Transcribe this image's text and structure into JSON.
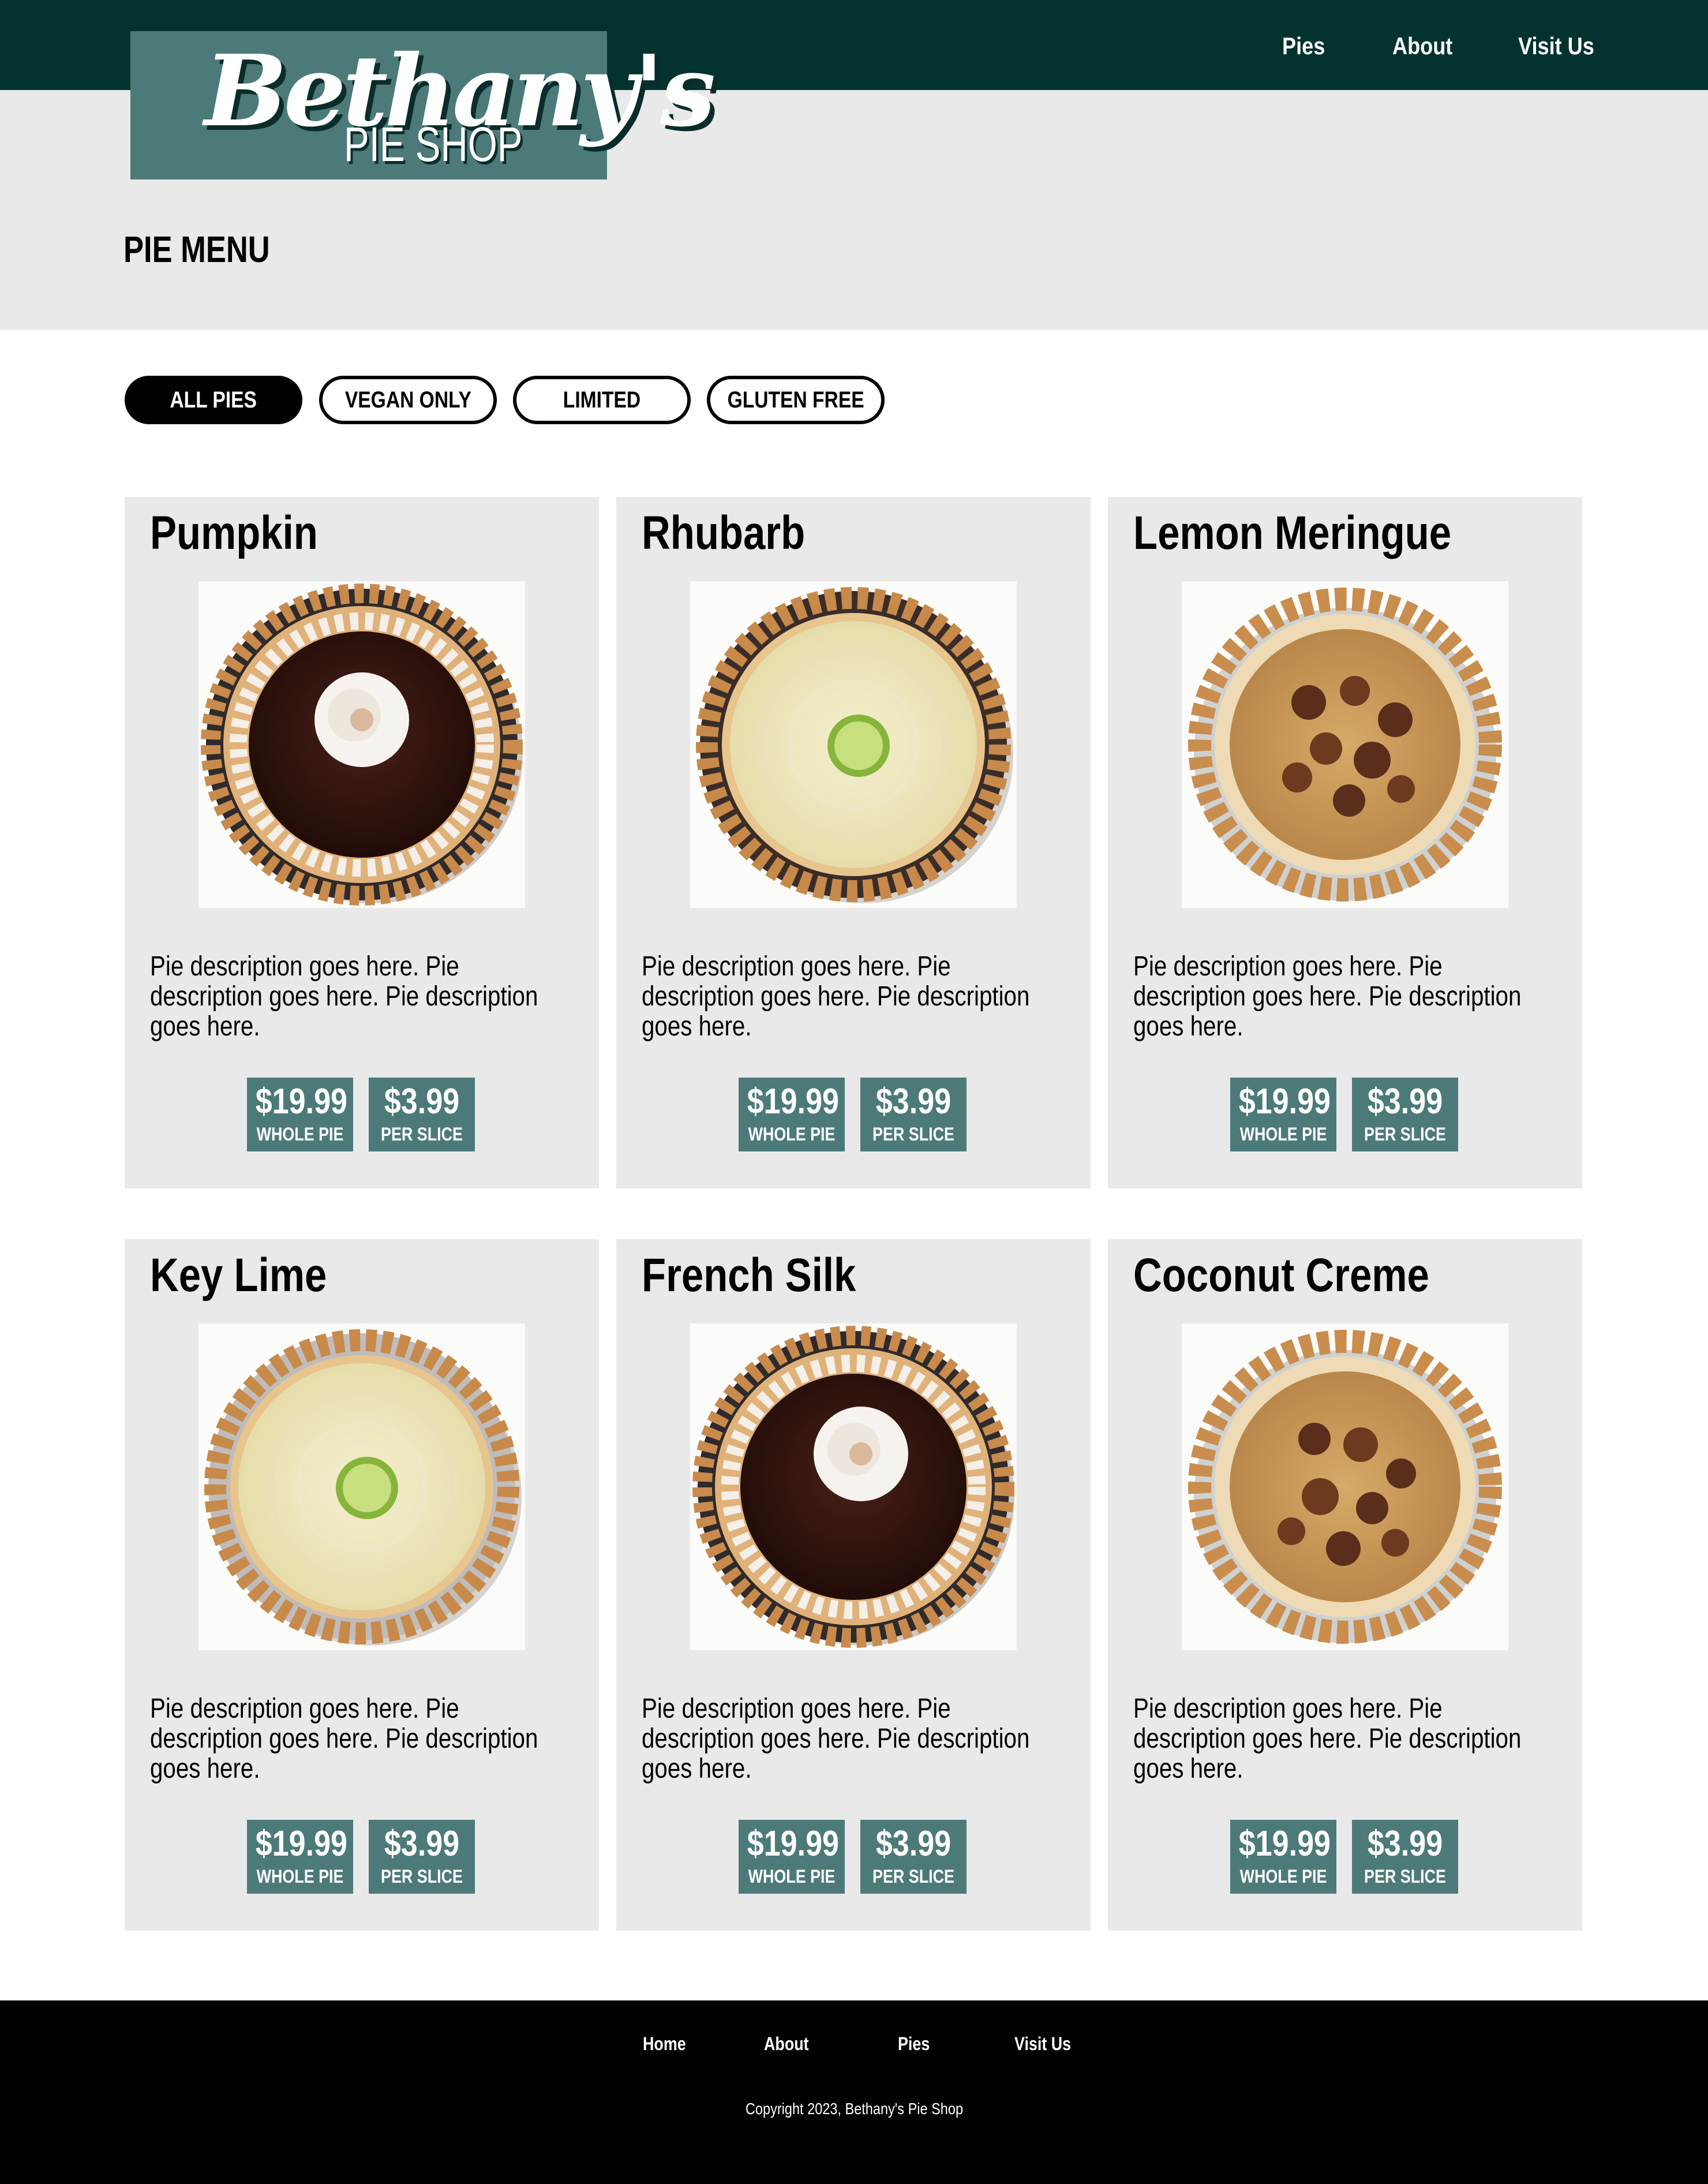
{
  "brand": {
    "script": "Bethany's",
    "sub": "PIE SHOP"
  },
  "nav": {
    "items": [
      "Pies",
      "About",
      "Visit Us"
    ]
  },
  "hero": {
    "title": "PIE MENU"
  },
  "filters": [
    {
      "label": "ALL PIES",
      "active": true
    },
    {
      "label": "VEGAN ONLY",
      "active": false
    },
    {
      "label": "LIMITED",
      "active": false
    },
    {
      "label": "GLUTEN FREE",
      "active": false
    }
  ],
  "pies": [
    {
      "name": "Pumpkin",
      "image": "chocolate-pie-photo",
      "description": "Pie description goes here. Pie description goes here. Pie description goes here.",
      "whole_price": "$19.99",
      "whole_label": "WHOLE PIE",
      "slice_price": "$3.99",
      "slice_label": "PER SLICE"
    },
    {
      "name": "Rhubarb",
      "image": "cream-lime-pie-photo",
      "description": "Pie description goes here. Pie description goes here. Pie description goes here.",
      "whole_price": "$19.99",
      "whole_label": "WHOLE PIE",
      "slice_price": "$3.99",
      "slice_label": "PER SLICE"
    },
    {
      "name": "Lemon Meringue",
      "image": "crumble-pie-photo",
      "description": "Pie description goes here. Pie description goes here. Pie description goes here.",
      "whole_price": "$19.99",
      "whole_label": "WHOLE PIE",
      "slice_price": "$3.99",
      "slice_label": "PER SLICE"
    },
    {
      "name": "Key Lime",
      "image": "cream-lime-pie-photo",
      "description": "Pie description goes here. Pie description goes here. Pie description goes here.",
      "whole_price": "$19.99",
      "whole_label": "WHOLE PIE",
      "slice_price": "$3.99",
      "slice_label": "PER SLICE"
    },
    {
      "name": "French Silk",
      "image": "chocolate-pie-photo",
      "description": "Pie description goes here. Pie description goes here. Pie description goes here.",
      "whole_price": "$19.99",
      "whole_label": "WHOLE PIE",
      "slice_price": "$3.99",
      "slice_label": "PER SLICE"
    },
    {
      "name": "Coconut Creme",
      "image": "crumble-pie-photo",
      "description": "Pie description goes here. Pie description goes here. Pie description goes here.",
      "whole_price": "$19.99",
      "whole_label": "WHOLE PIE",
      "slice_price": "$3.99",
      "slice_label": "PER SLICE"
    }
  ],
  "footer": {
    "links": [
      "Home",
      "About",
      "Pies",
      "Visit Us"
    ],
    "copyright": "Copyright 2023, Bethany's Pie Shop"
  },
  "colors": {
    "header": "#04332f",
    "accent": "#4c7a79",
    "panel": "#e9e9ea",
    "footer": "#000000"
  }
}
